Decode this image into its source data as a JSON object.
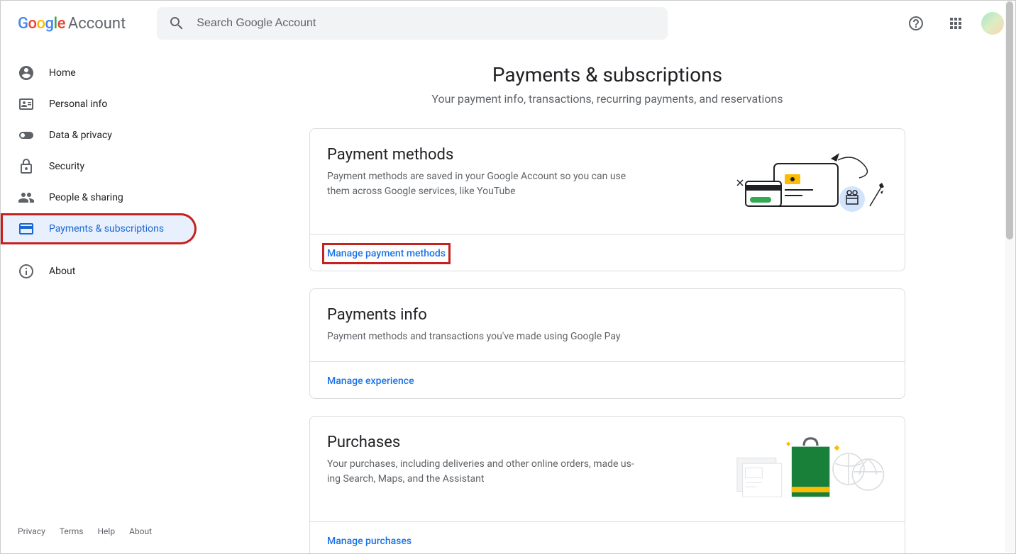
{
  "header": {
    "logo_account": "Account",
    "search_placeholder": "Search Google Account"
  },
  "sidebar": {
    "items": [
      {
        "id": "home",
        "label": "Home"
      },
      {
        "id": "personal",
        "label": "Personal info"
      },
      {
        "id": "privacy",
        "label": "Data & privacy"
      },
      {
        "id": "security",
        "label": "Security"
      },
      {
        "id": "sharing",
        "label": "People & sharing"
      },
      {
        "id": "payments",
        "label": "Payments & subscriptions"
      },
      {
        "id": "about",
        "label": "About"
      }
    ]
  },
  "footer": {
    "privacy": "Privacy",
    "terms": "Terms",
    "help": "Help",
    "about": "About"
  },
  "page": {
    "title": "Payments & subscriptions",
    "subtitle": "Your payment info, transactions, recurring payments, and reservations"
  },
  "cards": {
    "payment_methods": {
      "title": "Payment methods",
      "desc": "Payment methods are saved in your Google Account so you can use them across Google services, like YouTube",
      "action": "Manage payment methods"
    },
    "payments_info": {
      "title": "Payments info",
      "desc": "Payment methods and transactions you've made using Google Pay",
      "action": "Manage experience"
    },
    "purchases": {
      "title": "Purchases",
      "desc": "Your purchases, including deliveries and other online orders, made us­ing Search, Maps, and the Assistant",
      "action": "Manage purchases"
    }
  }
}
